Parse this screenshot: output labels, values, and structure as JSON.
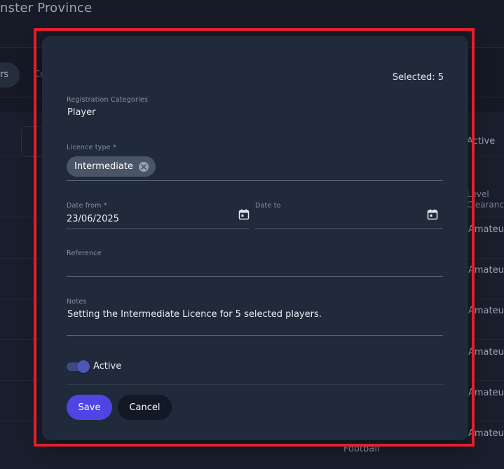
{
  "background": {
    "title": "nster Province",
    "chip_text": "rs",
    "tab_text": "Co",
    "active_header": "Active",
    "column_header_line1": "Level",
    "column_header_line2": "Clearance",
    "rows": [
      "Amateur",
      "Amateur",
      "Amateur",
      "Amateur",
      "Amateur",
      "Amateur"
    ],
    "footer_text": "Football"
  },
  "dialog": {
    "selected": "Selected: 5",
    "registration_categories": {
      "label": "Registration Categories",
      "value": "Player"
    },
    "licence_type": {
      "label": "Licence type *",
      "chip": "Intermediate"
    },
    "date_from": {
      "label": "Date from *",
      "value": "23/06/2025"
    },
    "date_to": {
      "label": "Date to",
      "value": ""
    },
    "reference": {
      "label": "Reference",
      "value": ""
    },
    "notes": {
      "label": "Notes",
      "value": "Setting the Intermediate Licence for 5 selected players."
    },
    "active_toggle": {
      "label": "Active",
      "on": true
    },
    "save_label": "Save",
    "cancel_label": "Cancel"
  },
  "colors": {
    "highlight": "#e0202a",
    "primary": "#4f45e4",
    "dialog_bg": "#212a3a"
  }
}
